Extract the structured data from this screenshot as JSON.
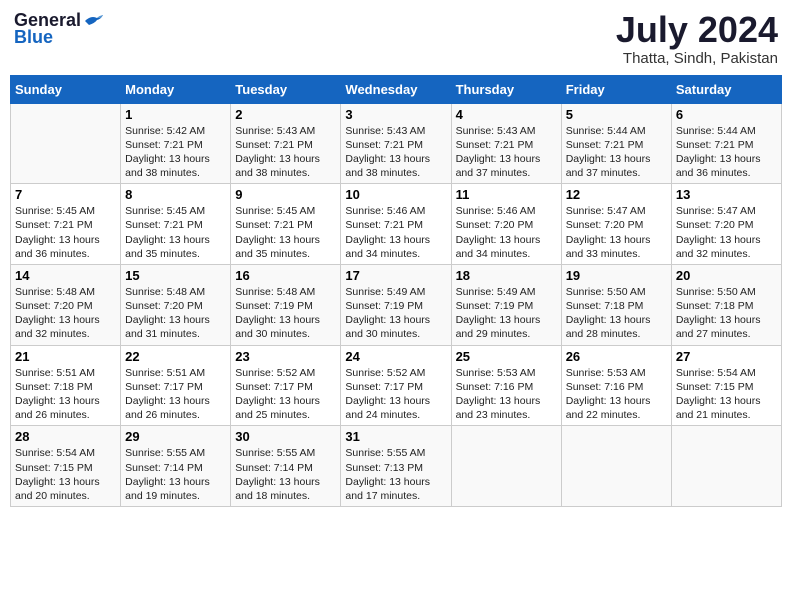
{
  "header": {
    "logo_general": "General",
    "logo_blue": "Blue",
    "month_year": "July 2024",
    "location": "Thatta, Sindh, Pakistan"
  },
  "days_of_week": [
    "Sunday",
    "Monday",
    "Tuesday",
    "Wednesday",
    "Thursday",
    "Friday",
    "Saturday"
  ],
  "weeks": [
    [
      {
        "day": "",
        "info": ""
      },
      {
        "day": "1",
        "info": "Sunrise: 5:42 AM\nSunset: 7:21 PM\nDaylight: 13 hours\nand 38 minutes."
      },
      {
        "day": "2",
        "info": "Sunrise: 5:43 AM\nSunset: 7:21 PM\nDaylight: 13 hours\nand 38 minutes."
      },
      {
        "day": "3",
        "info": "Sunrise: 5:43 AM\nSunset: 7:21 PM\nDaylight: 13 hours\nand 38 minutes."
      },
      {
        "day": "4",
        "info": "Sunrise: 5:43 AM\nSunset: 7:21 PM\nDaylight: 13 hours\nand 37 minutes."
      },
      {
        "day": "5",
        "info": "Sunrise: 5:44 AM\nSunset: 7:21 PM\nDaylight: 13 hours\nand 37 minutes."
      },
      {
        "day": "6",
        "info": "Sunrise: 5:44 AM\nSunset: 7:21 PM\nDaylight: 13 hours\nand 36 minutes."
      }
    ],
    [
      {
        "day": "7",
        "info": "Sunrise: 5:45 AM\nSunset: 7:21 PM\nDaylight: 13 hours\nand 36 minutes."
      },
      {
        "day": "8",
        "info": "Sunrise: 5:45 AM\nSunset: 7:21 PM\nDaylight: 13 hours\nand 35 minutes."
      },
      {
        "day": "9",
        "info": "Sunrise: 5:45 AM\nSunset: 7:21 PM\nDaylight: 13 hours\nand 35 minutes."
      },
      {
        "day": "10",
        "info": "Sunrise: 5:46 AM\nSunset: 7:21 PM\nDaylight: 13 hours\nand 34 minutes."
      },
      {
        "day": "11",
        "info": "Sunrise: 5:46 AM\nSunset: 7:20 PM\nDaylight: 13 hours\nand 34 minutes."
      },
      {
        "day": "12",
        "info": "Sunrise: 5:47 AM\nSunset: 7:20 PM\nDaylight: 13 hours\nand 33 minutes."
      },
      {
        "day": "13",
        "info": "Sunrise: 5:47 AM\nSunset: 7:20 PM\nDaylight: 13 hours\nand 32 minutes."
      }
    ],
    [
      {
        "day": "14",
        "info": "Sunrise: 5:48 AM\nSunset: 7:20 PM\nDaylight: 13 hours\nand 32 minutes."
      },
      {
        "day": "15",
        "info": "Sunrise: 5:48 AM\nSunset: 7:20 PM\nDaylight: 13 hours\nand 31 minutes."
      },
      {
        "day": "16",
        "info": "Sunrise: 5:48 AM\nSunset: 7:19 PM\nDaylight: 13 hours\nand 30 minutes."
      },
      {
        "day": "17",
        "info": "Sunrise: 5:49 AM\nSunset: 7:19 PM\nDaylight: 13 hours\nand 30 minutes."
      },
      {
        "day": "18",
        "info": "Sunrise: 5:49 AM\nSunset: 7:19 PM\nDaylight: 13 hours\nand 29 minutes."
      },
      {
        "day": "19",
        "info": "Sunrise: 5:50 AM\nSunset: 7:18 PM\nDaylight: 13 hours\nand 28 minutes."
      },
      {
        "day": "20",
        "info": "Sunrise: 5:50 AM\nSunset: 7:18 PM\nDaylight: 13 hours\nand 27 minutes."
      }
    ],
    [
      {
        "day": "21",
        "info": "Sunrise: 5:51 AM\nSunset: 7:18 PM\nDaylight: 13 hours\nand 26 minutes."
      },
      {
        "day": "22",
        "info": "Sunrise: 5:51 AM\nSunset: 7:17 PM\nDaylight: 13 hours\nand 26 minutes."
      },
      {
        "day": "23",
        "info": "Sunrise: 5:52 AM\nSunset: 7:17 PM\nDaylight: 13 hours\nand 25 minutes."
      },
      {
        "day": "24",
        "info": "Sunrise: 5:52 AM\nSunset: 7:17 PM\nDaylight: 13 hours\nand 24 minutes."
      },
      {
        "day": "25",
        "info": "Sunrise: 5:53 AM\nSunset: 7:16 PM\nDaylight: 13 hours\nand 23 minutes."
      },
      {
        "day": "26",
        "info": "Sunrise: 5:53 AM\nSunset: 7:16 PM\nDaylight: 13 hours\nand 22 minutes."
      },
      {
        "day": "27",
        "info": "Sunrise: 5:54 AM\nSunset: 7:15 PM\nDaylight: 13 hours\nand 21 minutes."
      }
    ],
    [
      {
        "day": "28",
        "info": "Sunrise: 5:54 AM\nSunset: 7:15 PM\nDaylight: 13 hours\nand 20 minutes."
      },
      {
        "day": "29",
        "info": "Sunrise: 5:55 AM\nSunset: 7:14 PM\nDaylight: 13 hours\nand 19 minutes."
      },
      {
        "day": "30",
        "info": "Sunrise: 5:55 AM\nSunset: 7:14 PM\nDaylight: 13 hours\nand 18 minutes."
      },
      {
        "day": "31",
        "info": "Sunrise: 5:55 AM\nSunset: 7:13 PM\nDaylight: 13 hours\nand 17 minutes."
      },
      {
        "day": "",
        "info": ""
      },
      {
        "day": "",
        "info": ""
      },
      {
        "day": "",
        "info": ""
      }
    ]
  ]
}
